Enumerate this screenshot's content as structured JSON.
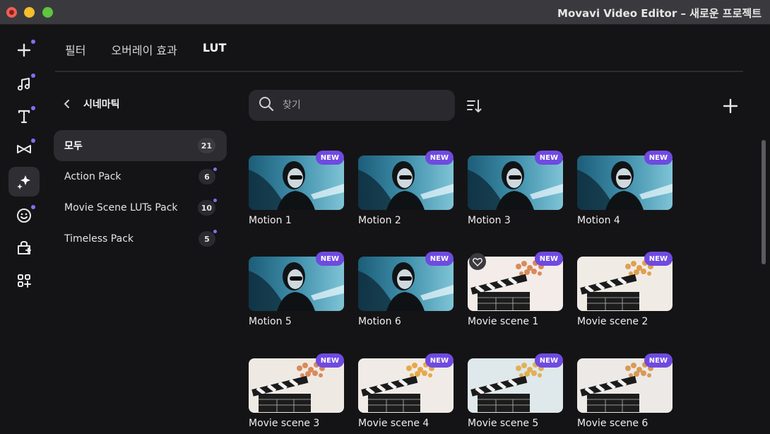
{
  "window": {
    "title": "Movavi Video Editor – 새로운 프로젝트"
  },
  "tabs": [
    {
      "label": "필터",
      "active": false
    },
    {
      "label": "오버레이 효과",
      "active": false
    },
    {
      "label": "LUT",
      "active": true
    }
  ],
  "rail": [
    {
      "icon": "plus-icon",
      "dot": true,
      "active": false
    },
    {
      "icon": "music-icon",
      "dot": true,
      "active": false
    },
    {
      "icon": "text-icon",
      "dot": true,
      "active": false
    },
    {
      "icon": "transition-icon",
      "dot": true,
      "active": false
    },
    {
      "icon": "effects-icon",
      "dot": false,
      "active": true
    },
    {
      "icon": "sticker-icon",
      "dot": true,
      "active": false
    },
    {
      "icon": "store-icon",
      "dot": false,
      "active": false
    },
    {
      "icon": "more-apps-icon",
      "dot": false,
      "active": false
    }
  ],
  "category": {
    "title": "시네마틱",
    "items": [
      {
        "label": "모두",
        "count": "21",
        "active": true,
        "dot": false
      },
      {
        "label": "Action Pack",
        "count": "6",
        "active": false,
        "dot": true
      },
      {
        "label": "Movie Scene LUTs Pack",
        "count": "10",
        "active": false,
        "dot": true
      },
      {
        "label": "Timeless Pack",
        "count": "5",
        "active": false,
        "dot": true
      }
    ]
  },
  "search": {
    "placeholder": "찾기"
  },
  "badge_label": "NEW",
  "items": [
    {
      "label": "Motion 1",
      "kind": "portrait"
    },
    {
      "label": "Motion 2",
      "kind": "portrait"
    },
    {
      "label": "Motion 3",
      "kind": "portrait"
    },
    {
      "label": "Motion 4",
      "kind": "portrait"
    },
    {
      "label": "Motion 5",
      "kind": "portrait"
    },
    {
      "label": "Motion 6",
      "kind": "portrait"
    },
    {
      "label": "Movie scene 1",
      "kind": "clapper",
      "favorite": true
    },
    {
      "label": "Movie scene 2",
      "kind": "clapper"
    },
    {
      "label": "Movie scene 3",
      "kind": "clapper"
    },
    {
      "label": "Movie scene 4",
      "kind": "clapper"
    },
    {
      "label": "Movie scene 5",
      "kind": "clapper"
    },
    {
      "label": "Movie scene 6",
      "kind": "clapper"
    }
  ],
  "colors": {
    "accent": "#6f4ae0",
    "dot": "#8a6cf0"
  }
}
